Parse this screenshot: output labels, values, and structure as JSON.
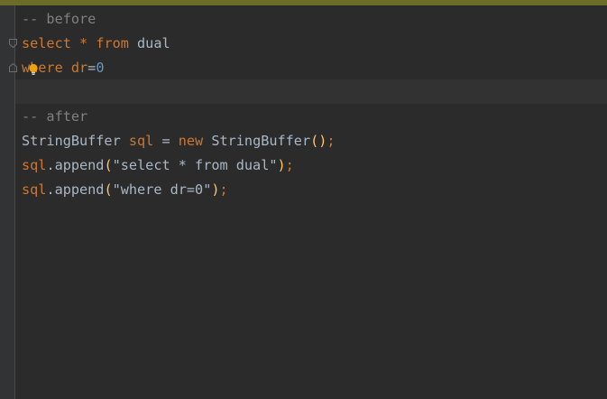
{
  "colors": {
    "background": "#2b2b2b",
    "gutter": "#313335",
    "keyword": "#cc7832",
    "comment": "#808080",
    "number": "#6897bb",
    "text": "#a9b7c6",
    "paren": "#ffc66d",
    "bulb": "#f0a30a"
  },
  "icons": {
    "fold_open": "fold-open-icon",
    "fold_close": "fold-close-icon",
    "intention": "lightbulb-icon"
  },
  "code": {
    "line1": {
      "comment": "-- before"
    },
    "line2": {
      "kw1": "select",
      "op": " * ",
      "kw2": "from",
      "rest": " dual"
    },
    "line3": {
      "kw": "where",
      "sp": " ",
      "ident": "dr",
      "eq": "=",
      "num": "0"
    },
    "line4": {
      "text": ""
    },
    "line5": {
      "comment": "-- after"
    },
    "line6": {
      "type": "StringBuffer",
      "sp1": " ",
      "var": "sql",
      "eq": " = ",
      "kw": "new",
      "sp2": " ",
      "ctor": "StringBuffer",
      "paren": "()",
      "semi": ";"
    },
    "line7": {
      "var": "sql",
      "call": ".append",
      "open": "(",
      "str": "\"select * from dual\"",
      "close": ")",
      "semi": ";"
    },
    "line8": {
      "var": "sql",
      "call": ".append",
      "open": "(",
      "str": "\"where dr=0\"",
      "close": ")",
      "semi": ";"
    }
  }
}
